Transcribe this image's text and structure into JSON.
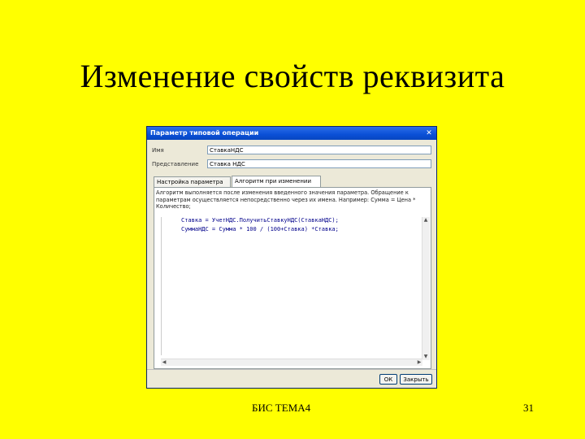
{
  "slide": {
    "title": "Изменение свойств реквизита",
    "footer_left": "БИС ТЕМА4",
    "page_number": "31"
  },
  "window": {
    "title": "Параметр типовой операции",
    "close_glyph": "✕",
    "fields": {
      "name_label": "Имя",
      "name_value": "СтавкаНДС",
      "repr_label": "Представление",
      "repr_value": "Ставка НДС"
    },
    "tabs": [
      {
        "label": "Настройка параметра",
        "active": false
      },
      {
        "label": "Алгоритм при изменении",
        "active": true
      }
    ],
    "description": "Алгоритм выполняется после изменения введенного значения параметра. Обращение к параметрам осуществляется непосредственно через их имена. Например: Сумма = Цена * Количество;",
    "code": [
      "Ставка = УчетНДС.ПолучитьСтавкуНДС(СтавкаНДС);",
      "СуммаНДС = Сумма * 100 / (100+Ставка) *Ставка;"
    ],
    "buttons": {
      "ok": "ОК",
      "close": "Закрыть"
    }
  }
}
